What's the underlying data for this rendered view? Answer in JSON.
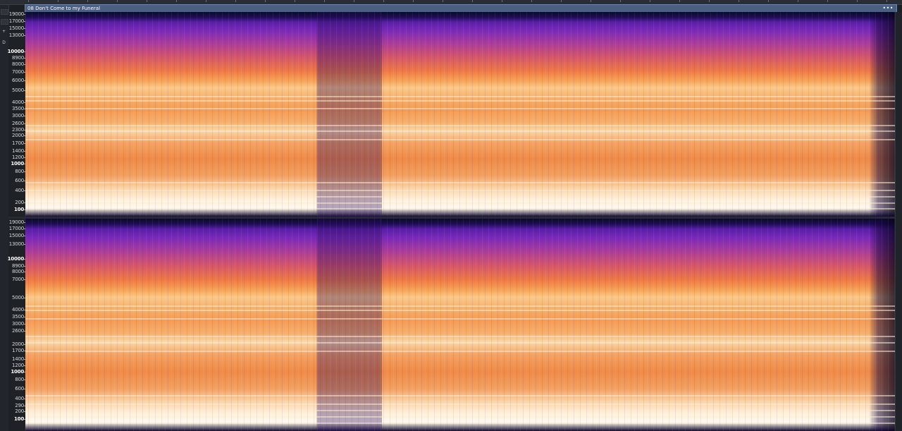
{
  "clip": {
    "title": "08 Don't Come to my Funeral",
    "menu_label": "•••",
    "header_color": "#4a5f82"
  },
  "side_panel": {
    "buttons": [
      "+",
      "D"
    ]
  },
  "channels": [
    {
      "id": "top",
      "freq_labels": [
        {
          "text": "19000",
          "bold": false
        },
        {
          "text": "17000",
          "bold": false
        },
        {
          "text": "15000",
          "bold": false
        },
        {
          "text": "13000",
          "bold": false
        },
        {
          "text": "10000",
          "bold": true
        },
        {
          "text": "8900",
          "bold": false
        },
        {
          "text": "8000",
          "bold": false
        },
        {
          "text": "7000",
          "bold": false
        },
        {
          "text": "6000",
          "bold": false
        },
        {
          "text": "5000",
          "bold": false
        },
        {
          "text": "4000",
          "bold": false
        },
        {
          "text": "3500",
          "bold": false
        },
        {
          "text": "3000",
          "bold": false
        },
        {
          "text": "2600",
          "bold": false
        },
        {
          "text": "2300",
          "bold": false
        },
        {
          "text": "2000",
          "bold": false
        },
        {
          "text": "1700",
          "bold": false
        },
        {
          "text": "1400",
          "bold": false
        },
        {
          "text": "1200",
          "bold": false
        },
        {
          "text": "1000",
          "bold": true
        },
        {
          "text": "800",
          "bold": false
        },
        {
          "text": "600",
          "bold": false
        },
        {
          "text": "400",
          "bold": false
        },
        {
          "text": "200",
          "bold": false
        },
        {
          "text": "100",
          "bold": true
        }
      ]
    },
    {
      "id": "bottom",
      "freq_labels": [
        {
          "text": "19000",
          "bold": false
        },
        {
          "text": "17000",
          "bold": false
        },
        {
          "text": "15000",
          "bold": false
        },
        {
          "text": "13000",
          "bold": false
        },
        {
          "text": "10000",
          "bold": true
        },
        {
          "text": "8900",
          "bold": false
        },
        {
          "text": "8000",
          "bold": false
        },
        {
          "text": "7000",
          "bold": false
        },
        {
          "text": "5000",
          "bold": false
        },
        {
          "text": "4000",
          "bold": false
        },
        {
          "text": "3500",
          "bold": false
        },
        {
          "text": "3000",
          "bold": false
        },
        {
          "text": "2600",
          "bold": false
        },
        {
          "text": "2000",
          "bold": false
        },
        {
          "text": "1700",
          "bold": false
        },
        {
          "text": "1400",
          "bold": false
        },
        {
          "text": "1200",
          "bold": false
        },
        {
          "text": "1000",
          "bold": true
        },
        {
          "text": "800",
          "bold": false
        },
        {
          "text": "600",
          "bold": false
        },
        {
          "text": "400",
          "bold": false
        },
        {
          "text": "290",
          "bold": false
        },
        {
          "text": "200",
          "bold": false
        },
        {
          "text": "100",
          "bold": true
        }
      ]
    }
  ],
  "colors": {
    "spectrum_low": "#0b0a26",
    "spectrum_mid": "#a83c9c",
    "spectrum_high": "#fff9ef",
    "background": "#1c1f24"
  }
}
